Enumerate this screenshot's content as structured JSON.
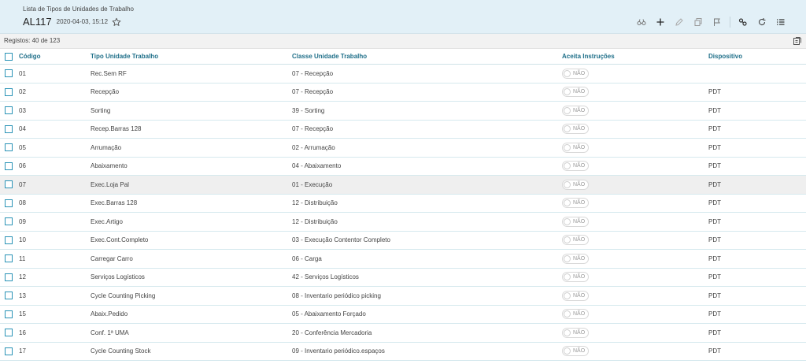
{
  "header": {
    "subtitle": "Lista de Tipos de Unidades de Trabalho",
    "code": "AL117",
    "timestamp": "2020-04-03, 15:12",
    "star_icon": "star-outline-icon",
    "toolbar_icons": [
      "binoculars-icon",
      "plus-icon",
      "pencil-icon",
      "copy-icon",
      "flag-icon",
      "link-icon",
      "refresh-icon",
      "list-icon"
    ]
  },
  "subbar": {
    "records": "Registos: 40 de 123",
    "export_icon": "export-icon"
  },
  "table": {
    "columns": [
      "Código",
      "Tipo Unidade Trabalho",
      "Classe Unidade Trabalho",
      "Aceita Instruções",
      "Dispositivo"
    ],
    "toggle_label": "NÃO",
    "rows": [
      {
        "code": "01",
        "tipo": "Rec.Sem RF",
        "classe": "07 - Recepção",
        "dispositivo": ""
      },
      {
        "code": "02",
        "tipo": "Recepção",
        "classe": "07 - Recepção",
        "dispositivo": "PDT"
      },
      {
        "code": "03",
        "tipo": "Sorting",
        "classe": "39 - Sorting",
        "dispositivo": "PDT"
      },
      {
        "code": "04",
        "tipo": "Recep.Barras 128",
        "classe": "07 - Recepção",
        "dispositivo": "PDT"
      },
      {
        "code": "05",
        "tipo": "Arrumação",
        "classe": "02 - Arrumação",
        "dispositivo": "PDT"
      },
      {
        "code": "06",
        "tipo": "Abaixamento",
        "classe": "04 - Abaixamento",
        "dispositivo": "PDT"
      },
      {
        "code": "07",
        "tipo": "Exec.Loja Pal",
        "classe": "01 - Execução",
        "dispositivo": "PDT"
      },
      {
        "code": "08",
        "tipo": "Exec.Barras 128",
        "classe": "12 - Distribuição",
        "dispositivo": "PDT"
      },
      {
        "code": "09",
        "tipo": "Exec.Artigo",
        "classe": "12 - Distribuição",
        "dispositivo": "PDT"
      },
      {
        "code": "10",
        "tipo": "Exec.Cont.Completo",
        "classe": "03 - Execução Contentor Completo",
        "dispositivo": "PDT"
      },
      {
        "code": "11",
        "tipo": "Carregar Carro",
        "classe": "06 - Carga",
        "dispositivo": "PDT"
      },
      {
        "code": "12",
        "tipo": "Serviços Logísticos",
        "classe": "42 - Serviços Logísticos",
        "dispositivo": "PDT"
      },
      {
        "code": "13",
        "tipo": "Cycle Counting Picking",
        "classe": "08 - Inventario periódico picking",
        "dispositivo": "PDT"
      },
      {
        "code": "15",
        "tipo": "Abaix.Pedido",
        "classe": "05 - Abaixamento Forçado",
        "dispositivo": "PDT"
      },
      {
        "code": "16",
        "tipo": "Conf. 1ª UMA",
        "classe": "20 - Conferência Mercadoria",
        "dispositivo": "PDT"
      },
      {
        "code": "17",
        "tipo": "Cycle Counting Stock",
        "classe": "09 - Inventario periódico.espaços",
        "dispositivo": "PDT"
      }
    ],
    "highlighted_row": "07"
  },
  "colors": {
    "header_bg": "#e2f0f7",
    "accent": "#1f6f89",
    "checkbox": "#2a93b6"
  }
}
